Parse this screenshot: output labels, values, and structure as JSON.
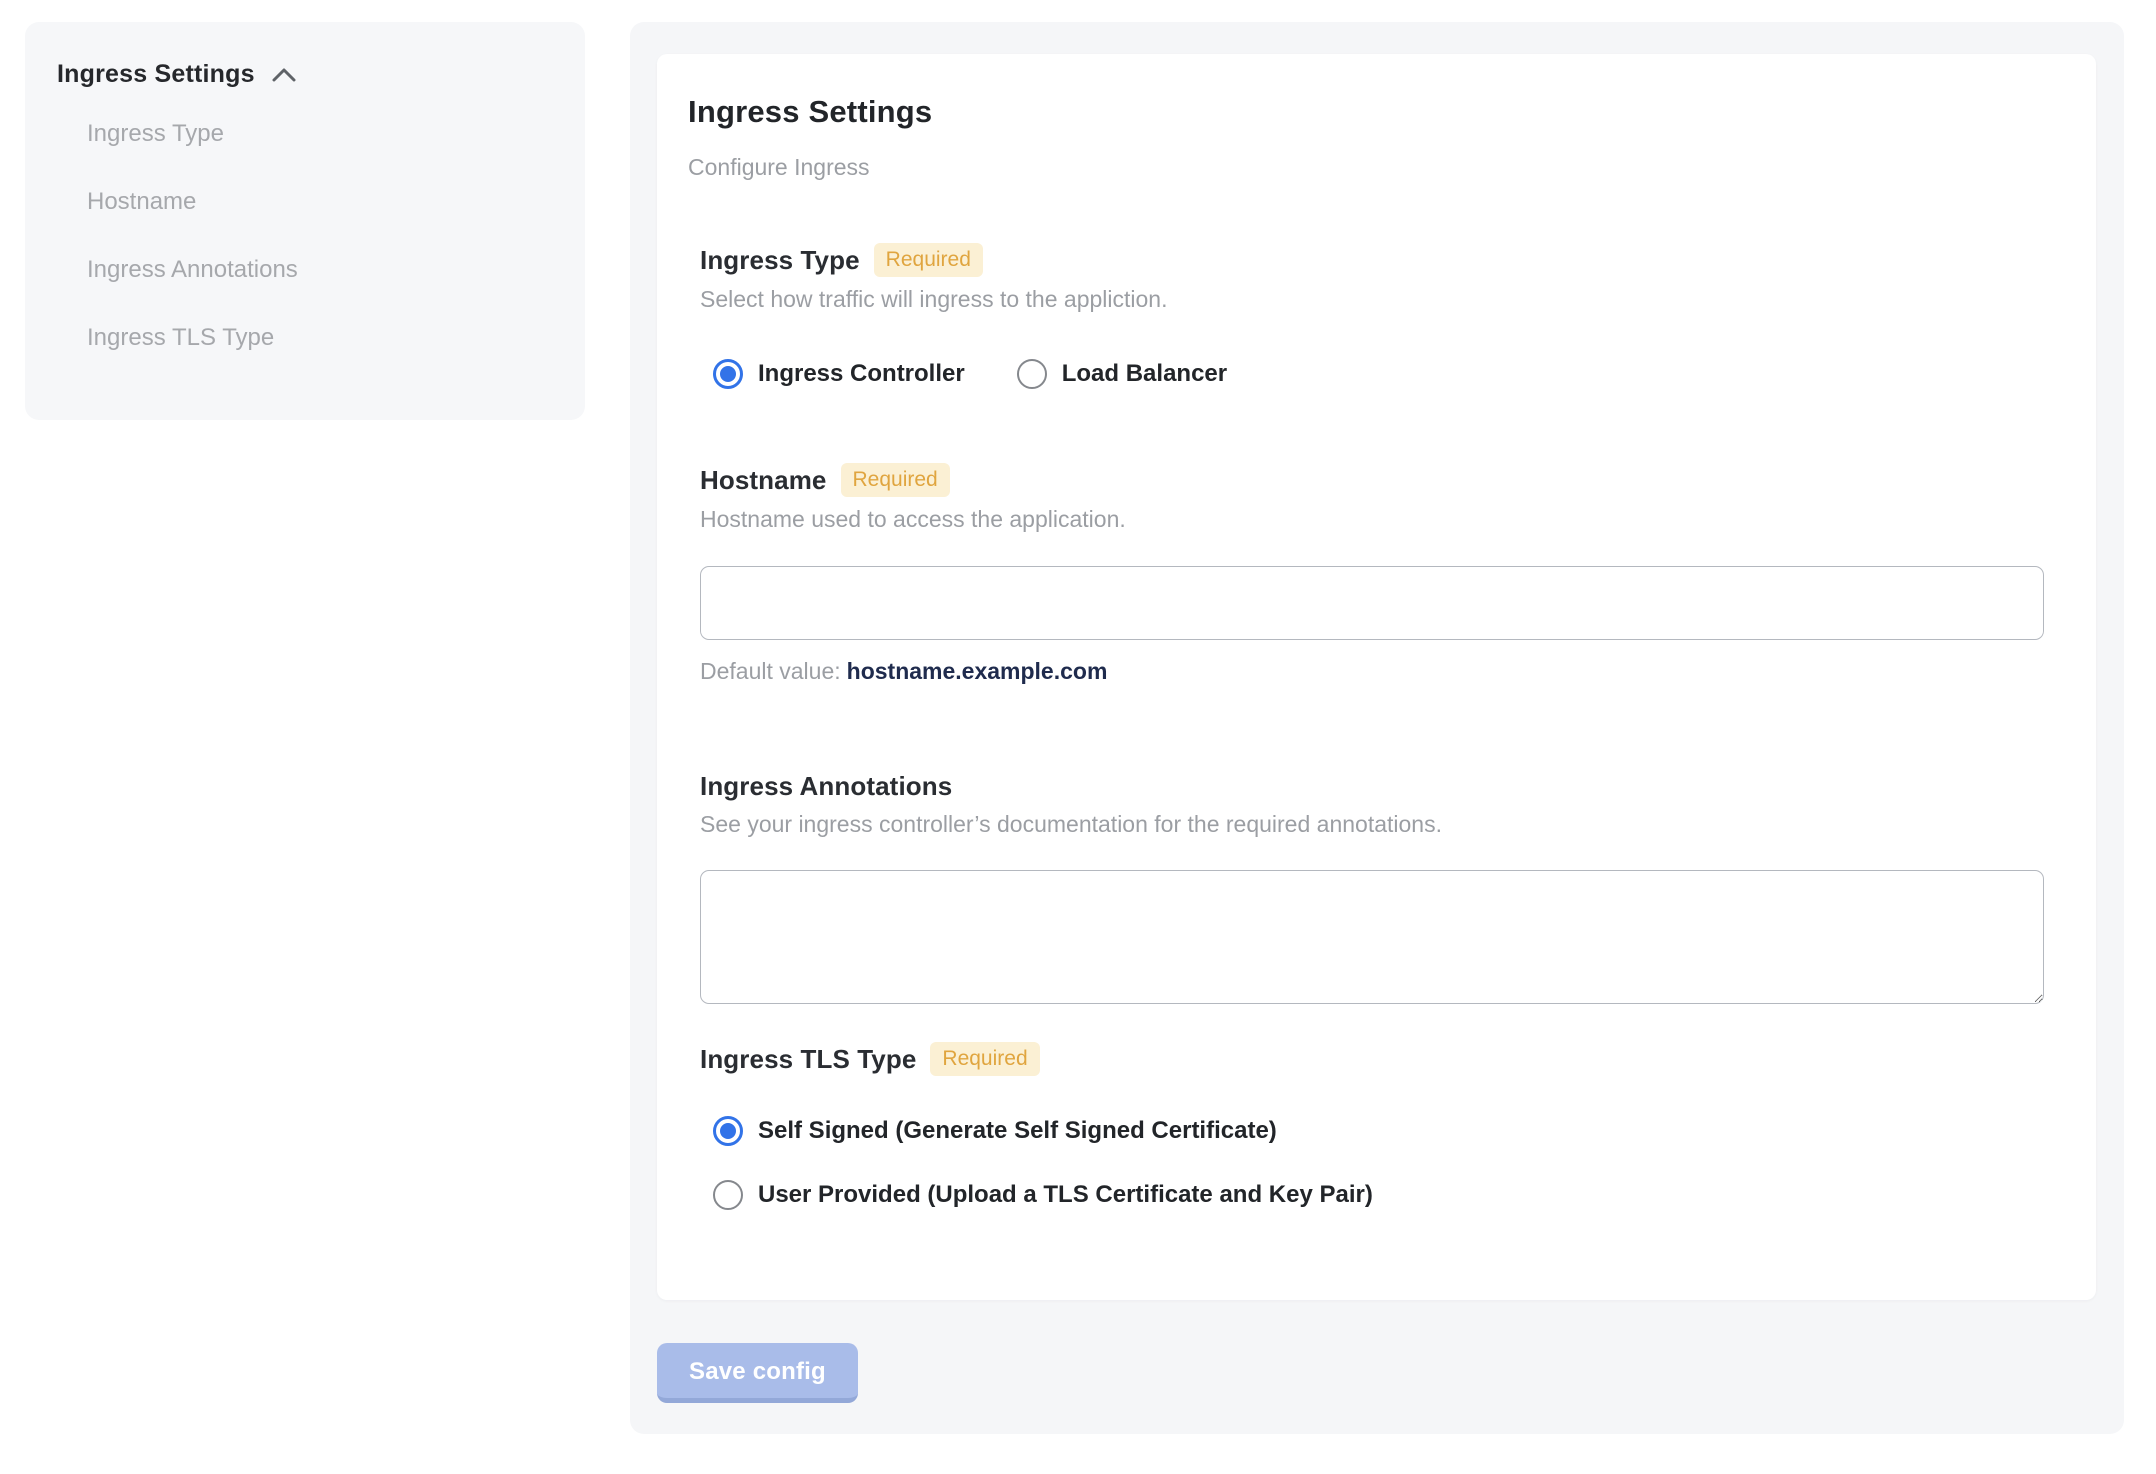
{
  "sidebar": {
    "header": "Ingress Settings",
    "collapse_icon": "chevron-up-icon",
    "items": [
      {
        "label": "Ingress Type"
      },
      {
        "label": "Hostname"
      },
      {
        "label": "Ingress Annotations"
      },
      {
        "label": "Ingress TLS Type"
      }
    ]
  },
  "main": {
    "title": "Ingress Settings",
    "subtitle": "Configure Ingress",
    "required_badge": "Required",
    "sections": {
      "ingress_type": {
        "label": "Ingress Type",
        "required": true,
        "description": "Select how traffic will ingress to the appliction.",
        "options": [
          {
            "label": "Ingress Controller",
            "selected": true
          },
          {
            "label": "Load Balancer",
            "selected": false
          }
        ]
      },
      "hostname": {
        "label": "Hostname",
        "required": true,
        "description": "Hostname used to access the application.",
        "input_value": "",
        "default_prefix": "Default value:",
        "default_value": "hostname.example.com"
      },
      "annotations": {
        "label": "Ingress Annotations",
        "required": false,
        "description": "See your ingress controller’s documentation for the required annotations.",
        "textarea_value": ""
      },
      "tls": {
        "label": "Ingress TLS Type",
        "required": true,
        "options": [
          {
            "label": "Self Signed (Generate Self Signed Certificate)",
            "selected": true
          },
          {
            "label": "User Provided (Upload a TLS Certificate and Key Pair)",
            "selected": false
          }
        ]
      }
    },
    "save_button_label": "Save config"
  },
  "colors": {
    "accent_blue": "#3273e8",
    "badge_bg": "#fbf0d4",
    "badge_text": "#e0a53f",
    "panel_bg": "#f5f6f8",
    "sidebar_bg": "#f6f7f9",
    "muted_text": "#9b9ea3",
    "default_value_text": "#1f2b4d",
    "save_button_bg": "#a9bce9"
  }
}
